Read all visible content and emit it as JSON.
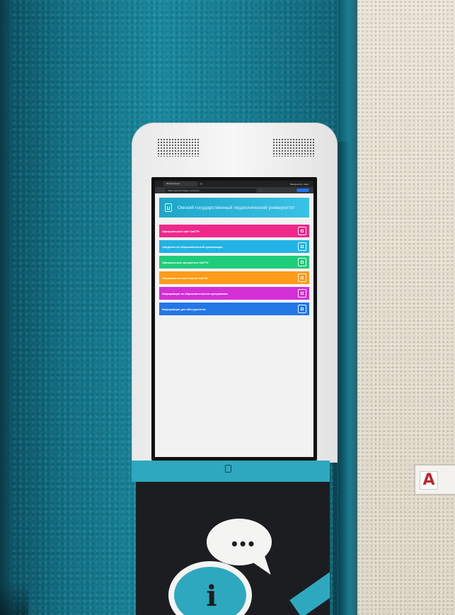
{
  "browser": {
    "tab_title": "Информаци",
    "new_tab": "+",
    "url": "https://kiosk.omgpu.ru/menu/",
    "right_button": "Завершить сеанс"
  },
  "site": {
    "title": "Омский государственный педагогический университет"
  },
  "menu": [
    {
      "label": "Официальный сайт ОмГПУ",
      "color": "#f0288c"
    },
    {
      "label": "Сведения об образовательной организации",
      "color": "#21b3e6"
    },
    {
      "label": "Официальные документы ОмГПУ",
      "color": "#1fcc7a"
    },
    {
      "label": "Образовательный портал ОмГПУ",
      "color": "#ff9b1a"
    },
    {
      "label": "Информация по образовательным программам",
      "color": "#d42fd6"
    },
    {
      "label": "Информация для абитуриентов",
      "color": "#2477e6"
    }
  ],
  "kiosk": {
    "bubble_dots": "•••",
    "info_glyph": "i"
  },
  "room_sign": {
    "letter": "А"
  }
}
